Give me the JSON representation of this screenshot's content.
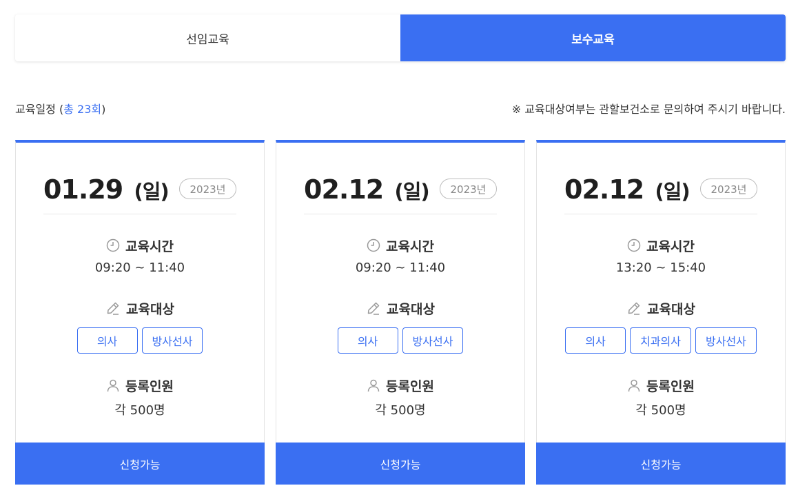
{
  "tabs": [
    {
      "label": "선임교육",
      "active": false
    },
    {
      "label": "보수교육",
      "active": true
    }
  ],
  "schedule": {
    "label_prefix": "교육일정 (",
    "label_count": "총 23회",
    "label_suffix": ")",
    "notice": "※ 교육대상여부는 관할보건소로 문의하여 주시기 바랍니다."
  },
  "labels": {
    "time": "교육시간",
    "target": "교육대상",
    "registration": "등록인원"
  },
  "cards": [
    {
      "date": "01.29",
      "dow": "(일)",
      "year": "2023년",
      "time": "09:20 ~ 11:40",
      "targets": [
        "의사",
        "방사선사"
      ],
      "registration": "각 500명",
      "status": "신청가능"
    },
    {
      "date": "02.12",
      "dow": "(일)",
      "year": "2023년",
      "time": "09:20 ~ 11:40",
      "targets": [
        "의사",
        "방사선사"
      ],
      "registration": "각 500명",
      "status": "신청가능"
    },
    {
      "date": "02.12",
      "dow": "(일)",
      "year": "2023년",
      "time": "13:20 ~ 15:40",
      "targets": [
        "의사",
        "치과의사",
        "방사선사"
      ],
      "registration": "각 500명",
      "status": "신청가능"
    }
  ],
  "icons": {
    "time": "clock-icon",
    "target": "pencil-icon",
    "registration": "person-icon"
  },
  "colors": {
    "accent": "#3a6ff2"
  }
}
